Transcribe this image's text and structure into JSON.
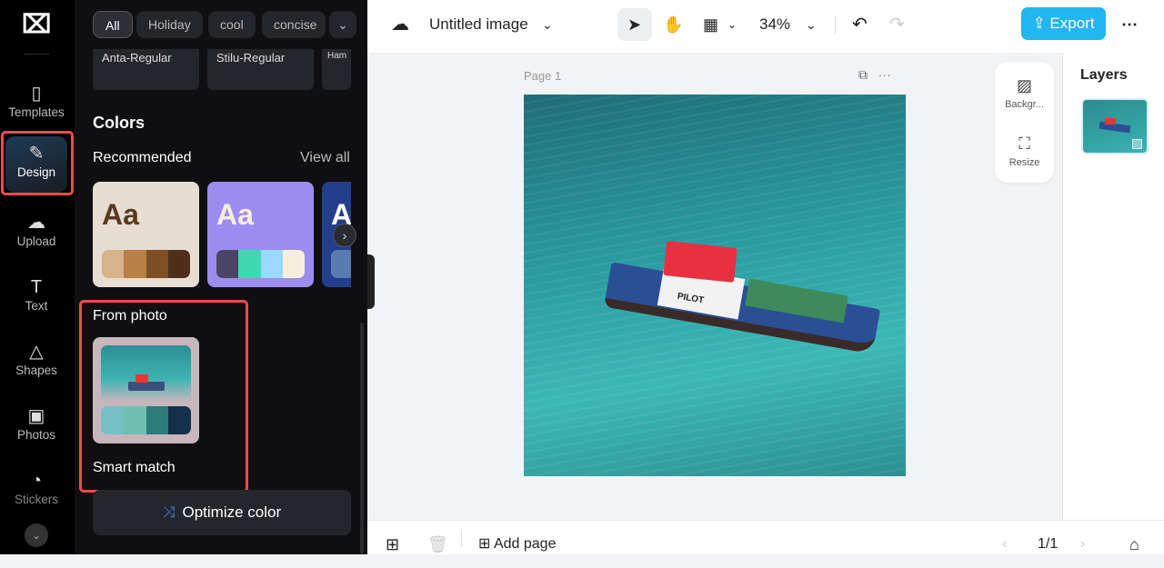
{
  "rail": {
    "items": [
      {
        "label": "Templates",
        "icon": "templates-icon"
      },
      {
        "label": "Design",
        "icon": "design-icon"
      },
      {
        "label": "Upload",
        "icon": "upload-icon"
      },
      {
        "label": "Text",
        "icon": "text-icon"
      },
      {
        "label": "Shapes",
        "icon": "shapes-icon"
      },
      {
        "label": "Photos",
        "icon": "photos-icon"
      },
      {
        "label": "Stickers",
        "icon": "stickers-icon"
      }
    ]
  },
  "panel": {
    "chips": [
      "All",
      "Holiday",
      "cool",
      "concise"
    ],
    "fonts": [
      "Anta-Regular",
      "Stilu-Regular",
      "Ham"
    ],
    "colors_title": "Colors",
    "recommended": "Recommended",
    "view_all": "View all",
    "cards": [
      {
        "aa": "Aa",
        "bg": "#e8ddd2",
        "fg": "#5a3a1e",
        "swatches": [
          "#d7b48a",
          "#b87f47",
          "#7e4f24",
          "#4e301a"
        ]
      },
      {
        "aa": "Aa",
        "bg": "#9d8cf0",
        "fg": "#f5efdc",
        "swatches": [
          "#4a4466",
          "#40d8b0",
          "#9ad8ff",
          "#f5f0dc"
        ]
      },
      {
        "aa": "A",
        "bg": "#233e8b",
        "fg": "#ffffff",
        "swatches": [
          "#5a7bb0"
        ]
      }
    ],
    "from_photo": "From photo",
    "photo_swatches": [
      "#77c0c7",
      "#6fc0b2",
      "#2b7c7a",
      "#15304b"
    ],
    "smart_match": "Smart match",
    "optimize": "Optimize color"
  },
  "topbar": {
    "title": "Untitled image",
    "zoom": "34%",
    "export": "Export"
  },
  "canvas": {
    "page_label": "Page 1",
    "boat_label": "PILOT"
  },
  "float_tools": {
    "background": "Backgr...",
    "resize": "Resize"
  },
  "layers": {
    "title": "Layers"
  },
  "bottom": {
    "add_page": "Add page",
    "page_count": "1/1"
  }
}
